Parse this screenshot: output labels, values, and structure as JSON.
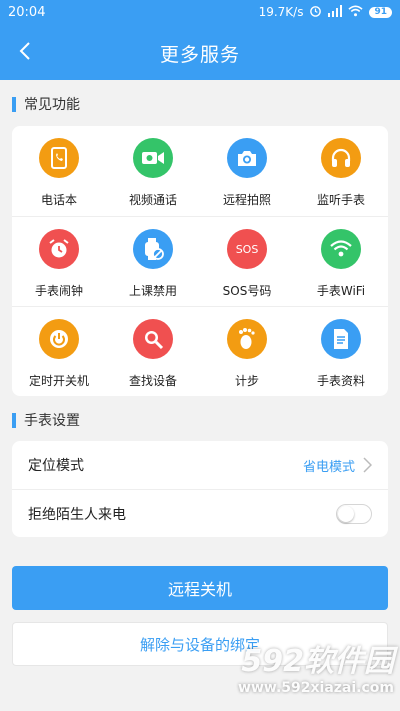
{
  "status_bar": {
    "time": "20:04",
    "net_speed": "19.7K/s",
    "battery": "91"
  },
  "header": {
    "title": "更多服务"
  },
  "common_functions": {
    "title": "常见功能",
    "items": [
      {
        "label": "电话本",
        "icon": "phonebook-icon",
        "color": "#f39c12"
      },
      {
        "label": "视频通话",
        "icon": "video-call-icon",
        "color": "#34c469"
      },
      {
        "label": "远程拍照",
        "icon": "camera-icon",
        "color": "#3a9ef3"
      },
      {
        "label": "监听手表",
        "icon": "headphones-icon",
        "color": "#f39c12"
      },
      {
        "label": "手表闹钟",
        "icon": "alarm-clock-icon",
        "color": "#f05050"
      },
      {
        "label": "上课禁用",
        "icon": "watch-disable-icon",
        "color": "#3a9ef3"
      },
      {
        "label": "SOS号码",
        "icon": "sos-icon",
        "color": "#f05050"
      },
      {
        "label": "手表WiFi",
        "icon": "wifi-icon",
        "color": "#34c469"
      },
      {
        "label": "定时开关机",
        "icon": "power-icon",
        "color": "#f39c12"
      },
      {
        "label": "查找设备",
        "icon": "search-icon",
        "color": "#f05050"
      },
      {
        "label": "计步",
        "icon": "footprint-icon",
        "color": "#f39c12"
      },
      {
        "label": "手表资料",
        "icon": "document-icon",
        "color": "#3a9ef3"
      }
    ]
  },
  "watch_settings": {
    "title": "手表设置",
    "location_mode_label": "定位模式",
    "location_mode_value": "省电模式",
    "reject_strangers_label": "拒绝陌生人来电",
    "reject_strangers_enabled": false
  },
  "actions": {
    "remote_shutdown": "远程关机",
    "unbind": "解除与设备的绑定"
  },
  "watermark": {
    "logo": "592软件园",
    "url": "www.592xiazai.com"
  },
  "colors": {
    "primary": "#3a9ef3",
    "orange": "#f39c12",
    "green": "#34c469",
    "red": "#f05050"
  }
}
